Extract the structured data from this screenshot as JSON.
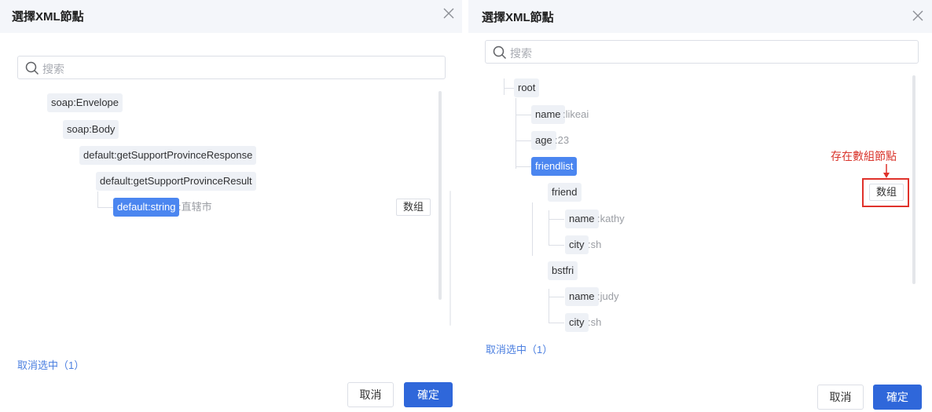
{
  "left_dialog": {
    "title": "選擇XML節點",
    "search_placeholder": "搜索",
    "nodes": [
      {
        "label": "soap:Envelope"
      },
      {
        "label": "soap:Body"
      },
      {
        "label": "default:getSupportProvinceResponse"
      },
      {
        "label": "default:getSupportProvinceResult"
      },
      {
        "label": "default:string",
        "value": ":直辖市"
      }
    ],
    "array_button": "数组",
    "clear_selection": "取消选中（1）",
    "cancel_label": "取消",
    "ok_label": "確定"
  },
  "right_dialog": {
    "title": "選擇XML節點",
    "search_placeholder": "搜索",
    "nodes": [
      {
        "label": "root"
      },
      {
        "label": "name",
        "value": ":likeai"
      },
      {
        "label": "age",
        "value": ":23"
      },
      {
        "label": "friendlist"
      },
      {
        "label": "friend"
      },
      {
        "label": "name",
        "value": ":kathy"
      },
      {
        "label": "city",
        "value": ":sh"
      },
      {
        "label": "bstfri"
      },
      {
        "label": "name",
        "value": ":judy"
      },
      {
        "label": "city",
        "value": ":sh"
      }
    ],
    "array_button": "数组",
    "annotation": "存在數組節點",
    "clear_selection": "取消选中（1）",
    "cancel_label": "取消",
    "ok_label": "確定"
  },
  "colors": {
    "primary": "#2f67da",
    "selected_node": "#4b86f0",
    "annotation_red": "#e0322b"
  }
}
